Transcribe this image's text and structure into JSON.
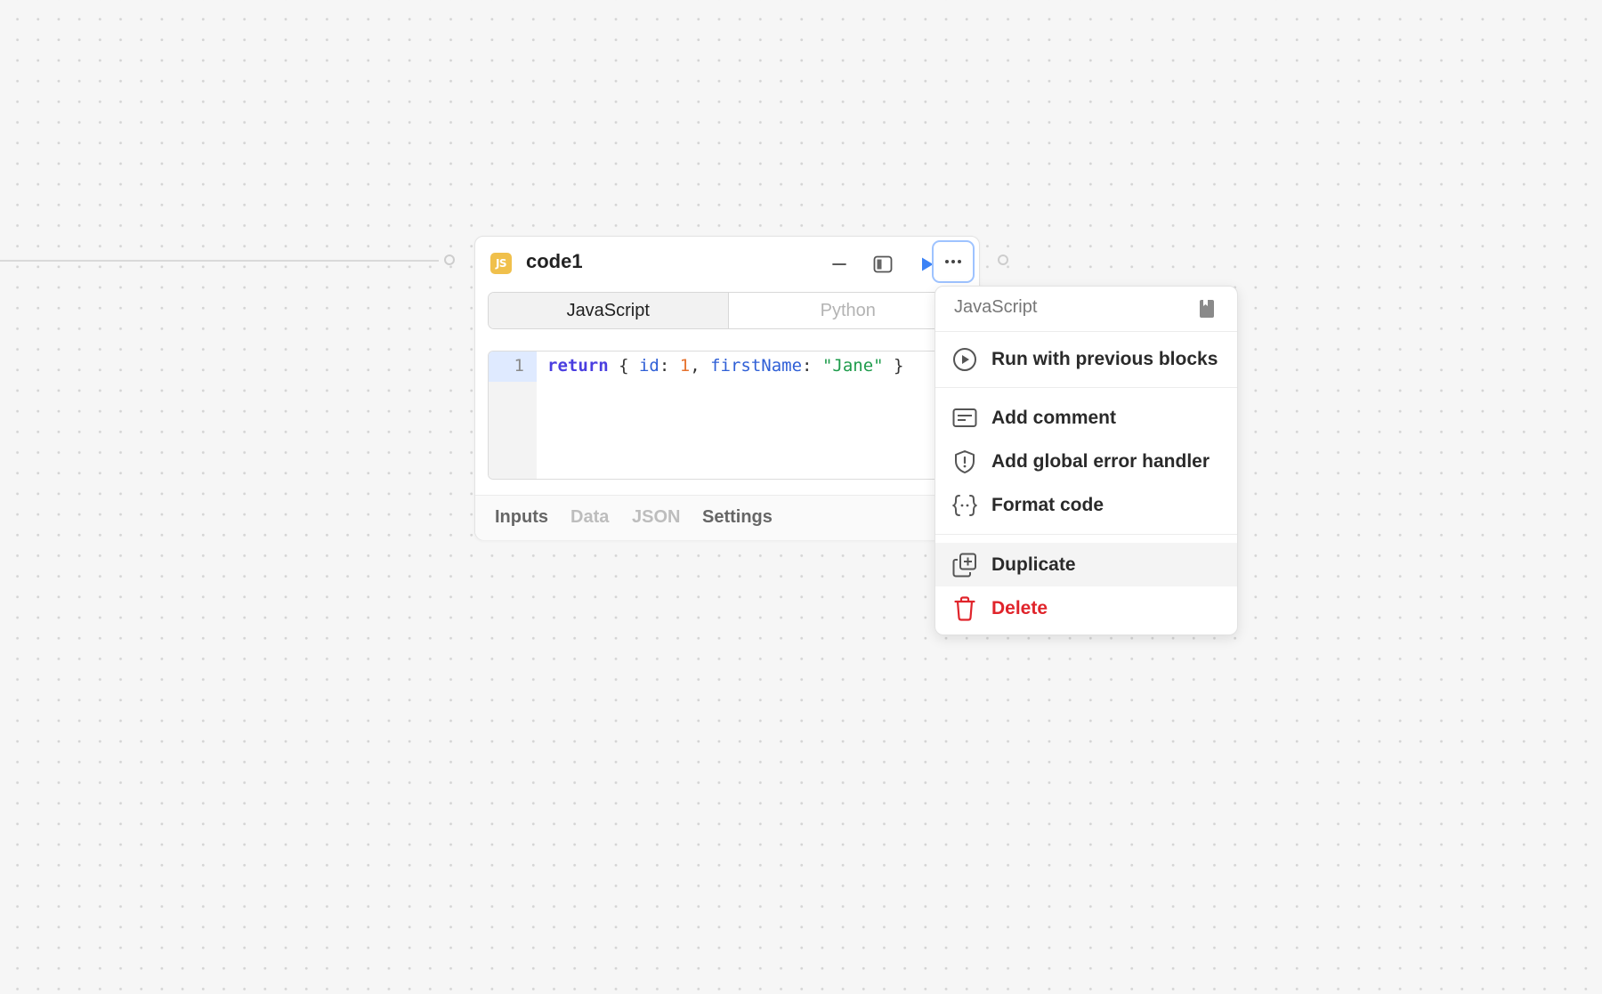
{
  "block": {
    "badge": "JS",
    "title": "code1",
    "language_tabs": [
      "JavaScript",
      "Python"
    ],
    "editor": {
      "line_number": "1",
      "code_tokens": {
        "keyword": "return",
        "open": " { ",
        "key1": "id",
        "colon1": ": ",
        "val1": "1",
        "comma": ", ",
        "key2": "firstName",
        "colon2": ": ",
        "val2": "\"Jane\"",
        "close": " }"
      }
    },
    "footer_tabs": [
      "Inputs",
      "Data",
      "JSON",
      "Settings"
    ]
  },
  "menu": {
    "header": "JavaScript",
    "items": [
      {
        "label": "Run with previous blocks",
        "icon": "play-circle-icon"
      },
      {
        "label": "Add comment",
        "icon": "comment-icon"
      },
      {
        "label": "Add global error handler",
        "icon": "shield-alert-icon"
      },
      {
        "label": "Format code",
        "icon": "braces-icon"
      },
      {
        "label": "Duplicate",
        "icon": "duplicate-icon"
      },
      {
        "label": "Delete",
        "icon": "trash-icon"
      }
    ]
  },
  "colors": {
    "accent": "#3b82f6",
    "danger": "#e0242b",
    "js_badge": "#f0c04c"
  }
}
